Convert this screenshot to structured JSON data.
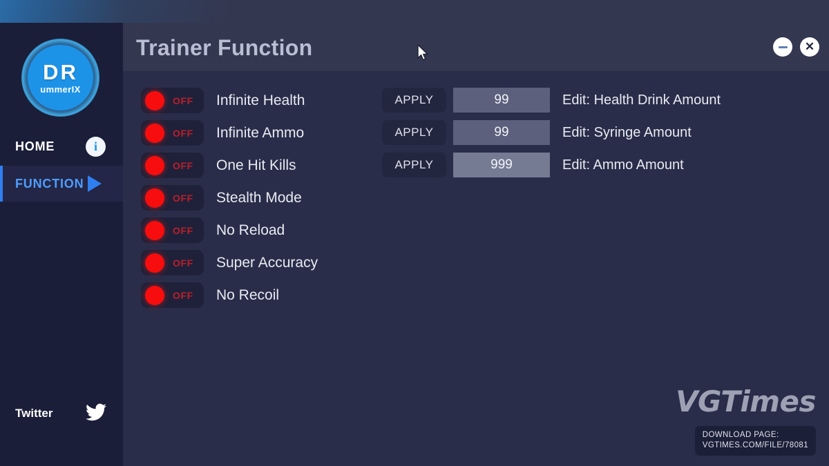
{
  "window": {
    "title": "Trainer Function",
    "minimize_label": "minimize",
    "close_label": "✕"
  },
  "sidebar": {
    "logo": {
      "primary": "DR",
      "secondary": "ummerIX"
    },
    "items": [
      {
        "label": "HOME",
        "icon": "info-icon",
        "active": false,
        "badge": "i"
      },
      {
        "label": "FUNCTION",
        "icon": "play-icon",
        "active": true
      }
    ],
    "social": {
      "label": "Twitter",
      "icon": "twitter-icon"
    }
  },
  "main": {
    "toggles": [
      {
        "label": "Infinite Health",
        "state": "OFF"
      },
      {
        "label": "Infinite Ammo",
        "state": "OFF"
      },
      {
        "label": "One Hit Kills",
        "state": "OFF"
      },
      {
        "label": "Stealth Mode",
        "state": "OFF"
      },
      {
        "label": "No Reload",
        "state": "OFF"
      },
      {
        "label": "Super Accuracy",
        "state": "OFF"
      },
      {
        "label": "No Recoil",
        "state": "OFF"
      }
    ],
    "edits": [
      {
        "button": "APPLY",
        "value": "99",
        "label": "Edit: Health Drink Amount",
        "focused": false
      },
      {
        "button": "APPLY",
        "value": "99",
        "label": "Edit: Syringe Amount",
        "focused": false
      },
      {
        "button": "APPLY",
        "value": "999",
        "label": "Edit: Ammo Amount",
        "focused": true
      }
    ]
  },
  "watermark": {
    "title": "VGTimes",
    "line1": "DOWNLOAD PAGE:",
    "line2": "VGTIMES.COM/FILE/78081"
  },
  "colors": {
    "background": "#2a2d49",
    "sidebar": "#1b1e39",
    "header": "#343750",
    "accent_blue": "#2f7ff0",
    "logo_blue": "#1d93e8",
    "toggle_red": "#f70d0d",
    "off_text": "#bb1f2b"
  }
}
